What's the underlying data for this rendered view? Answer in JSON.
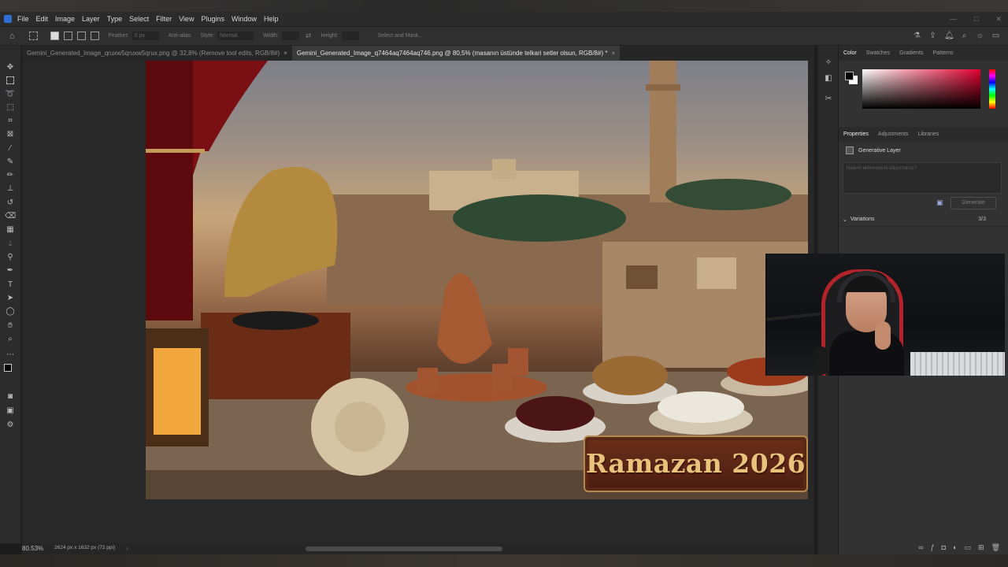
{
  "menu": {
    "items": [
      "File",
      "Edit",
      "Image",
      "Layer",
      "Type",
      "Select",
      "Filter",
      "View",
      "Plugins",
      "Window",
      "Help"
    ]
  },
  "options_bar": {
    "feather_label": "Feather:",
    "feather_value": "0 px",
    "antialias_label": "Anti-alias",
    "style_label": "Style:",
    "style_value": "Normal",
    "width_label": "Width:",
    "height_label": "Height:",
    "select_mask": "Select and Mask..."
  },
  "tabs": [
    {
      "label": "Gemini_Generated_Image_qruxw5qruxw5qrux.png @ 32,8% (Remove tool edits, RGB/8#)",
      "close": "×"
    },
    {
      "label": "Gemini_Generated_Image_q7464aq7464aq746.png @ 80,5% (masanın üstünde telkari setler olsun, RGB/8#) *",
      "close": "×"
    }
  ],
  "artwork": {
    "banner_text": "Ramazan 2026"
  },
  "status": {
    "zoom": "80.53%",
    "dimensions": "2624 px x 1632 px (72 ppi)"
  },
  "color_panel": {
    "tabs": [
      "Color",
      "Swatches",
      "Gradients",
      "Patterns"
    ]
  },
  "properties_panel": {
    "tabs": [
      "Properties",
      "Adjustments",
      "Libraries"
    ],
    "layer_type": "Generative Layer",
    "prompt_placeholder": "Nelerin eklenmesini istiyorsunuz?",
    "generate_label": "Generate",
    "variations_label": "Variations",
    "variations_count": "3/3"
  }
}
